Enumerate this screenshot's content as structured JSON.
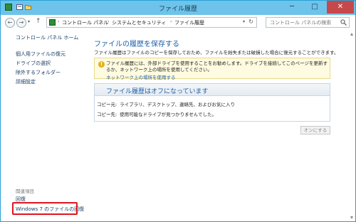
{
  "window": {
    "title": "ファイル履歴",
    "minimize": "─",
    "maximize": "□",
    "close": "✕"
  },
  "nav": {
    "back": "←",
    "forward": "→",
    "up": "↑",
    "dropdown": "▾",
    "refresh": "↻"
  },
  "breadcrumb": {
    "items": [
      "コントロール パネル",
      "システムとセキュリティ",
      "ファイル履歴"
    ],
    "separator": "›"
  },
  "search": {
    "placeholder": "コントロール パネルの検索"
  },
  "sidebar": {
    "home": "コントロール パネル ホーム",
    "links": [
      "個人用ファイルの復元",
      "ドライブの選択",
      "除外するフォルダー",
      "詳細設定"
    ],
    "related_heading": "関連項目",
    "related_links": [
      "回復",
      "Windows 7 のファイルの回復"
    ]
  },
  "main": {
    "title": "ファイルの履歴を保存する",
    "description": "ファイル履歴はファイルのコピーを保存しておため、ファイルを紛失または破損した場合に復元することができます。",
    "info": {
      "text": "ファイル履歴には、外部ドライブを使用することをお勧めします。ドライブを接続してこのページを更新するか、ネットワーク上の場所を使用してください。",
      "link": "ネットワーク上の場所を使用する"
    },
    "status": {
      "title": "ファイル履歴はオフになっています",
      "copy_from_label": "コピー元:",
      "copy_from_value": "ライブラリ、デスクトップ、連絡先、およびお気に入り",
      "copy_to_label": "コピー先:",
      "copy_to_value": "使用可能なドライブが見つかりませんでした。"
    },
    "turn_on_button": "オンにする"
  },
  "colors": {
    "titlebar": "#6ec3ea",
    "link": "#1c5fa8",
    "highlight": "#e0151c"
  }
}
